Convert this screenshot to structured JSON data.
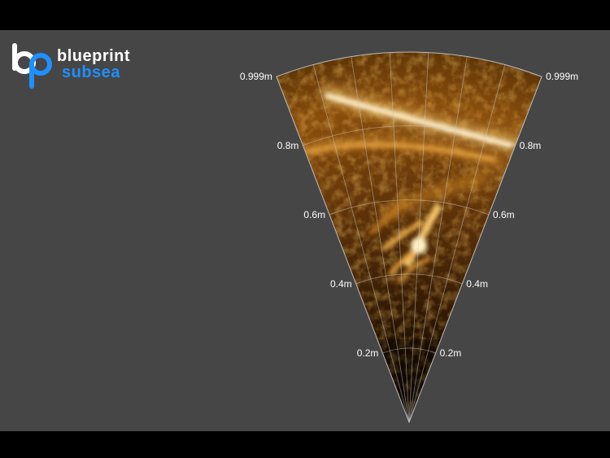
{
  "brand": {
    "name_top": "blueprint",
    "name_bottom": "subsea",
    "accent_color": "#1e90ff"
  },
  "sonar": {
    "palette": "copper",
    "max_range_m": 0.999,
    "range_rings": [
      {
        "left": "0.2m",
        "right": "0.2m"
      },
      {
        "left": "0.4m",
        "right": "0.4m"
      },
      {
        "left": "0.6m",
        "right": "0.6m"
      },
      {
        "left": "0.8m",
        "right": "0.8m"
      },
      {
        "left": "0.999m",
        "right": "0.999m"
      }
    ],
    "bearing_lines": 7,
    "background_color": "#464646"
  }
}
